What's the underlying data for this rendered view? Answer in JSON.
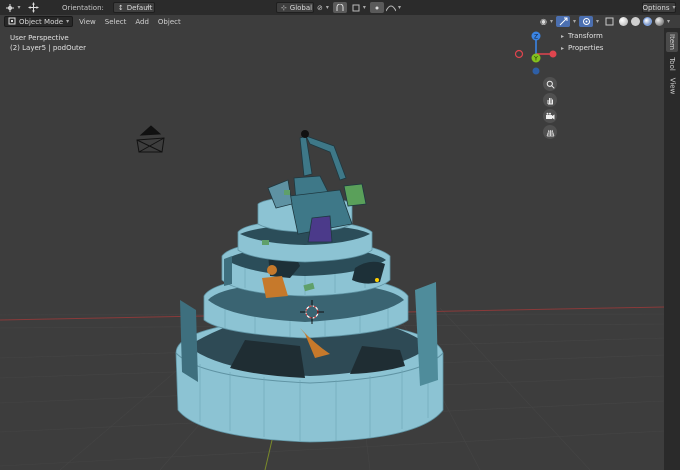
{
  "header": {
    "orientation_label": "Orientation:",
    "orientation_value": "Default",
    "transform_space": "Global",
    "options_label": "Options"
  },
  "modebar": {
    "mode": "Object Mode",
    "menus": [
      "View",
      "Select",
      "Add",
      "Object"
    ]
  },
  "viewport": {
    "perspective": "User Perspective",
    "collection": "(2) Layer5 | podOuter"
  },
  "npanel": {
    "panels": [
      "Transform",
      "Properties"
    ]
  },
  "sidebar_tabs": [
    "Item",
    "Tool",
    "View"
  ],
  "gizmo": {
    "axes": [
      "Z",
      "Y"
    ]
  },
  "colors": {
    "x_axis": "#e0454e",
    "y_axis": "#84c21d",
    "z_axis": "#3a84e4",
    "model": "#8cc3d3",
    "model_dark": "#2b4d59",
    "figure": "#c6792b"
  }
}
